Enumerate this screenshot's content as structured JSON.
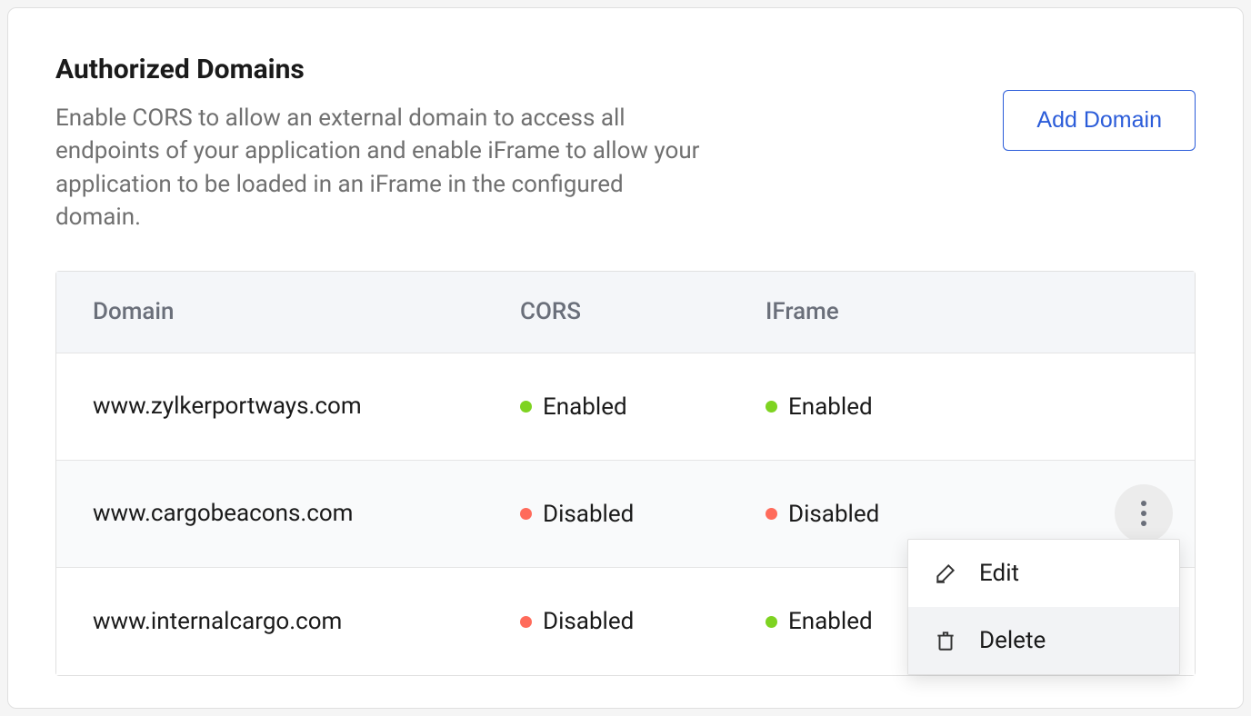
{
  "section": {
    "title": "Authorized Domains",
    "description": "Enable CORS to allow an external domain to access all endpoints of your application and enable iFrame to allow your application to be loaded in an iFrame in the configured domain.",
    "addButton": "Add Domain"
  },
  "table": {
    "headers": {
      "domain": "Domain",
      "cors": "CORS",
      "iframe": "IFrame"
    },
    "rows": [
      {
        "domain": "www.zylkerportways.com",
        "cors": "Enabled",
        "corsStatus": "green",
        "iframe": "Enabled",
        "iframeStatus": "green"
      },
      {
        "domain": "www.cargobeacons.com",
        "cors": "Disabled",
        "corsStatus": "red",
        "iframe": "Disabled",
        "iframeStatus": "red"
      },
      {
        "domain": "www.internalcargo.com",
        "cors": "Disabled",
        "corsStatus": "red",
        "iframe": "Enabled",
        "iframeStatus": "green"
      }
    ]
  },
  "menu": {
    "edit": "Edit",
    "delete": "Delete"
  }
}
